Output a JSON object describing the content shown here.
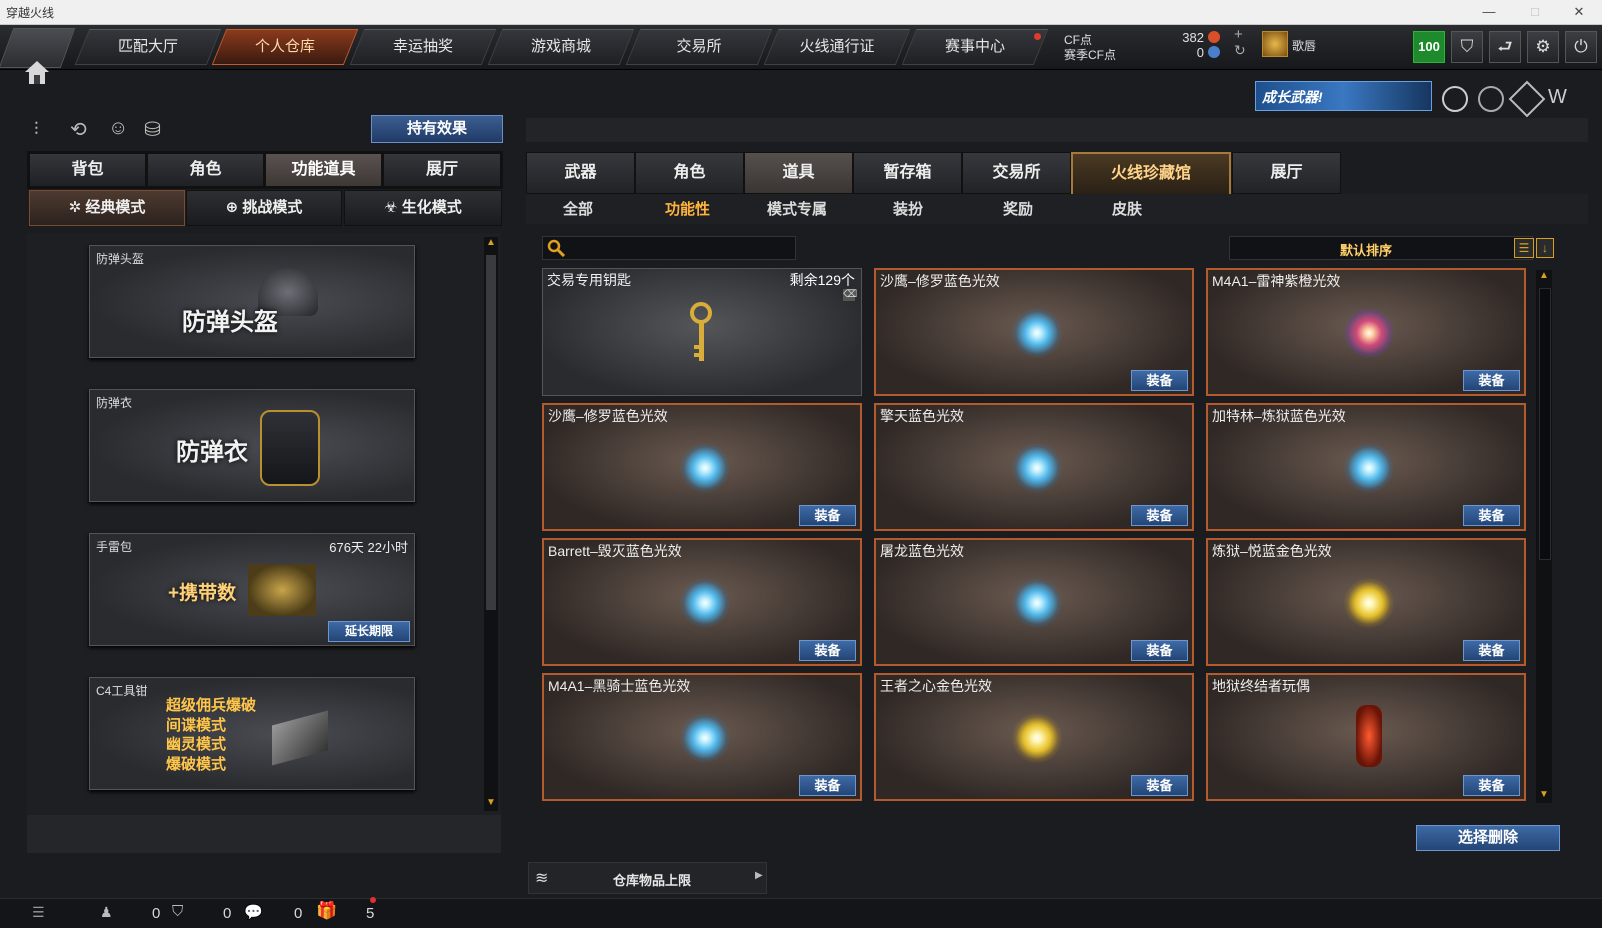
{
  "window": {
    "title": "穿越火线",
    "min": "—",
    "max": "□",
    "close": "✕"
  },
  "nav": {
    "tabs": [
      "匹配大厅",
      "个人仓库",
      "幸运抽奖",
      "游戏商城",
      "交易所",
      "火线通行证",
      "赛事中心"
    ],
    "active": 1
  },
  "account": {
    "cf_label": "CF点",
    "cf_value": "382",
    "season_label": "赛季CF点",
    "season_value": "0",
    "plus": "+",
    "refresh": "↻",
    "rank_name": "歌唇",
    "level": "100"
  },
  "banner": {
    "text": "成长武器!"
  },
  "left": {
    "effect_button": "持有效果",
    "tabs": [
      "背包",
      "角色",
      "功能道具",
      "展厅"
    ],
    "modes": [
      "经典模式",
      "挑战模式",
      "生化模式"
    ],
    "cards": [
      {
        "label": "防弹头盔",
        "big": "防弹头盔"
      },
      {
        "label": "防弹衣",
        "big": "防弹衣"
      },
      {
        "label": "手雷包",
        "big": "+携带数",
        "time": "676天 22小时",
        "extend": "延长期限"
      },
      {
        "label": "C4工具钳",
        "lines": [
          "超级佣兵爆破",
          "间谍模式",
          "幽灵模式",
          "爆破模式"
        ]
      }
    ]
  },
  "right": {
    "tabs": [
      "武器",
      "角色",
      "道具",
      "暂存箱",
      "交易所",
      "火线珍藏馆",
      "展厅"
    ],
    "subtabs": [
      "全部",
      "功能性",
      "模式专属",
      "装扮",
      "奖励",
      "皮肤"
    ],
    "search_placeholder": "",
    "sort_label": "默认排序",
    "items": [
      {
        "name": "交易专用钥匙",
        "count": "剩余129个",
        "kind": "key"
      },
      {
        "name": "沙鹰–修罗蓝色光效",
        "kind": "blue",
        "equip": "装备"
      },
      {
        "name": "M4A1–雷神紫橙光效",
        "kind": "purple",
        "equip": "装备"
      },
      {
        "name": "沙鹰–修罗蓝色光效",
        "kind": "blue",
        "equip": "装备"
      },
      {
        "name": "擎天蓝色光效",
        "kind": "blue",
        "equip": "装备"
      },
      {
        "name": "加特林–炼狱蓝色光效",
        "kind": "blue",
        "equip": "装备"
      },
      {
        "name": "Barrett–毁灭蓝色光效",
        "kind": "blue",
        "equip": "装备"
      },
      {
        "name": "屠龙蓝色光效",
        "kind": "blue",
        "equip": "装备"
      },
      {
        "name": "炼狱–悦蓝金色光效",
        "kind": "gold",
        "equip": "装备"
      },
      {
        "name": "M4A1–黑骑士蓝色光效",
        "kind": "blue",
        "equip": "装备"
      },
      {
        "name": "王者之心金色光效",
        "kind": "gold",
        "equip": "装备"
      },
      {
        "name": "地狱终结者玩偶",
        "kind": "doll",
        "equip": "装备"
      }
    ],
    "delete_button": "选择删除",
    "capacity_label": "仓库物品上限"
  },
  "status": {
    "friends": "0",
    "clan": "0",
    "gifts": "0",
    "notice": "5"
  }
}
